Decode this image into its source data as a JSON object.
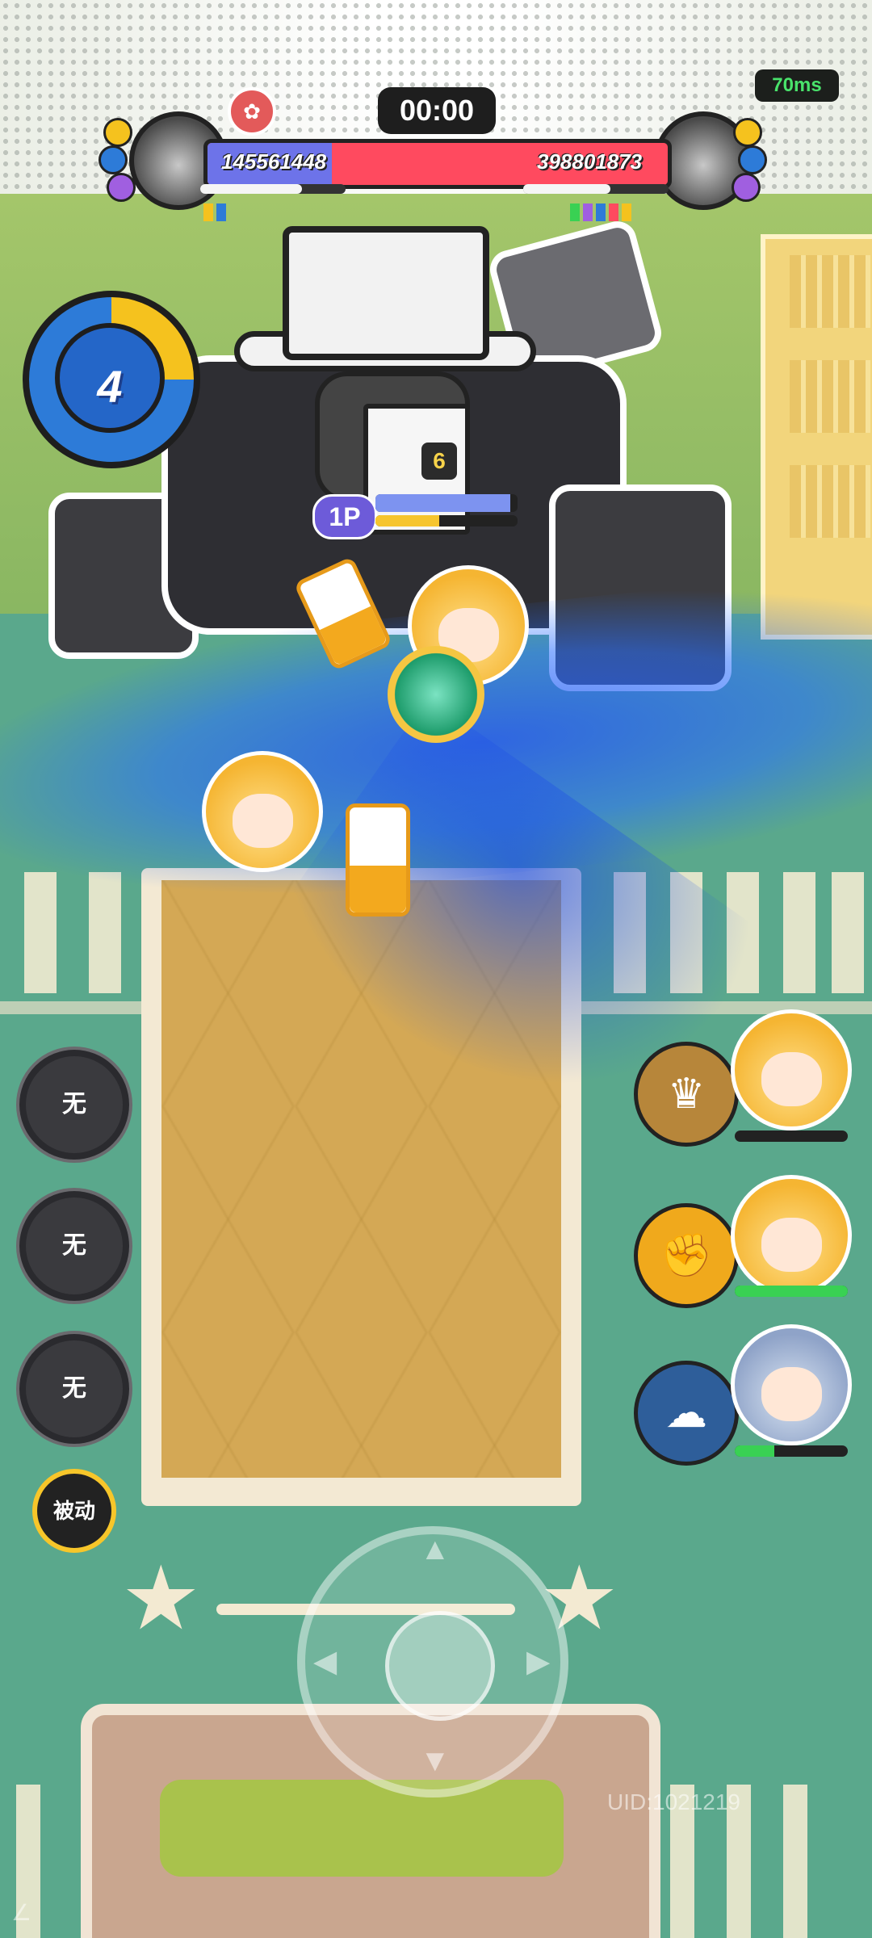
{
  "hud": {
    "timer": "00:00",
    "ping": "70ms",
    "left_team_score": "145561448",
    "right_team_score": "398801873",
    "left_share_fraction": 0.27,
    "left_subbar_fraction": 0.7,
    "right_subbar_fraction": 0.6,
    "colors": {
      "left_team": "#6d73e9",
      "right_team": "#ff4a5f",
      "ping": "#49e36b"
    }
  },
  "energy": {
    "value": "4",
    "fill_fraction": 0.25
  },
  "player": {
    "tag": "1P",
    "level": "6",
    "hp_fraction": 0.95,
    "mp_fraction": 0.45
  },
  "skills": [
    {
      "label": "无",
      "icon": "empty-skill-icon"
    },
    {
      "label": "无",
      "icon": "empty-skill-icon"
    },
    {
      "label": "无",
      "icon": "empty-skill-icon"
    }
  ],
  "passive_label": "被动",
  "teammates": [
    {
      "skill_icon": "crown-flame-icon",
      "skill_color": "#b7863a",
      "hp_fraction": 0.0
    },
    {
      "skill_icon": "fist-icon",
      "skill_color": "#f0a91c",
      "hp_fraction": 1.0
    },
    {
      "skill_icon": "cloud-swirl-icon",
      "skill_color": "#2e5e9a",
      "hp_fraction": 0.35
    }
  ],
  "uid": "UID:1021219"
}
